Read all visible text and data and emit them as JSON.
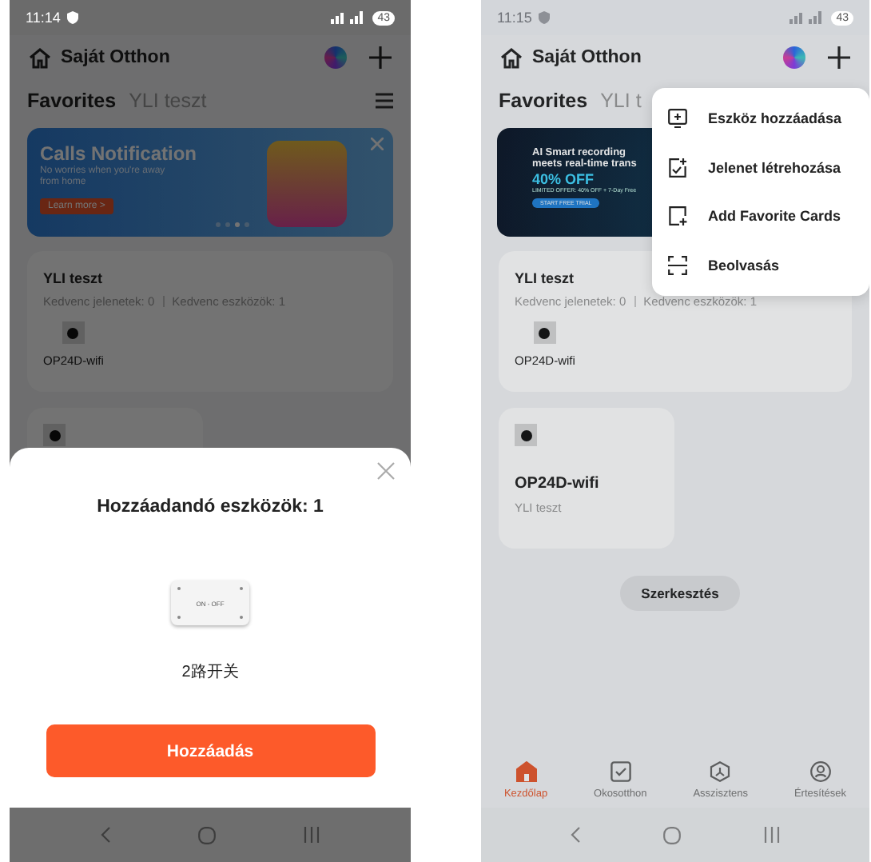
{
  "screens": [
    {
      "status_bar": {
        "time": "11:14",
        "battery": "43"
      },
      "header": {
        "title": "Saját Otthon"
      },
      "tabs": [
        {
          "label": "Favorites",
          "selected": true
        },
        {
          "label": "YLI teszt",
          "selected": false
        }
      ],
      "banner": {
        "kind": "calls",
        "title": "Calls Notification",
        "text": "No worries when you're away from home",
        "button": "Learn more >",
        "dots": [
          {
            "selected": false
          },
          {
            "selected": false
          },
          {
            "selected": true
          },
          {
            "selected": false
          }
        ]
      },
      "room_card": {
        "title": "YLI teszt",
        "stats": [
          "Kedvenc jelenetek: 0",
          "Kedvenc eszközök: 1"
        ],
        "devices": [
          "OP24D-wifi"
        ]
      },
      "device_cards": [
        {
          "kind": "icon_only"
        }
      ],
      "overlay": {
        "kind": "sheet",
        "title": "Hozzáadandó eszközök: 1",
        "device_label": "ON - OFF",
        "device_name": "2路开关",
        "button": "Hozzáadás"
      }
    },
    {
      "status_bar": {
        "time": "11:15",
        "battery": "43"
      },
      "header": {
        "title": "Saját Otthon"
      },
      "tabs": [
        {
          "label": "Favorites",
          "selected": true
        },
        {
          "label": "YLI t",
          "selected": false
        }
      ],
      "banner": {
        "kind": "promo",
        "lines": [
          "AI Smart recording",
          "meets real-time trans"
        ],
        "offer": "40% OFF",
        "fine_print": "LIMITED OFFER: 40% OFF + 7-Day Free",
        "button": "START FREE TRIAL"
      },
      "room_card": {
        "title": "YLI teszt",
        "stats": [
          "Kedvenc jelenetek: 0",
          "Kedvenc eszközök: 1"
        ],
        "devices": [
          "OP24D-wifi"
        ]
      },
      "device_cards": [
        {
          "kind": "full",
          "name": "OP24D-wifi",
          "room": "YLI teszt"
        }
      ],
      "edit_button": "Szerkesztés",
      "bottom_nav": [
        {
          "label": "Kezdőlap",
          "kind": "home",
          "selected": true
        },
        {
          "label": "Okosotthon",
          "kind": "smart",
          "selected": false
        },
        {
          "label": "Asszisztens",
          "kind": "assistant",
          "selected": false
        },
        {
          "label": "Értesítések",
          "kind": "profile",
          "selected": false
        }
      ],
      "overlay": {
        "kind": "menu",
        "items": [
          {
            "label": "Eszköz hozzáadása",
            "kind": "device"
          },
          {
            "label": "Jelenet létrehozása",
            "kind": "scene"
          },
          {
            "label": "Add Favorite Cards",
            "kind": "card"
          },
          {
            "label": "Beolvasás",
            "kind": "scan"
          }
        ]
      }
    }
  ]
}
